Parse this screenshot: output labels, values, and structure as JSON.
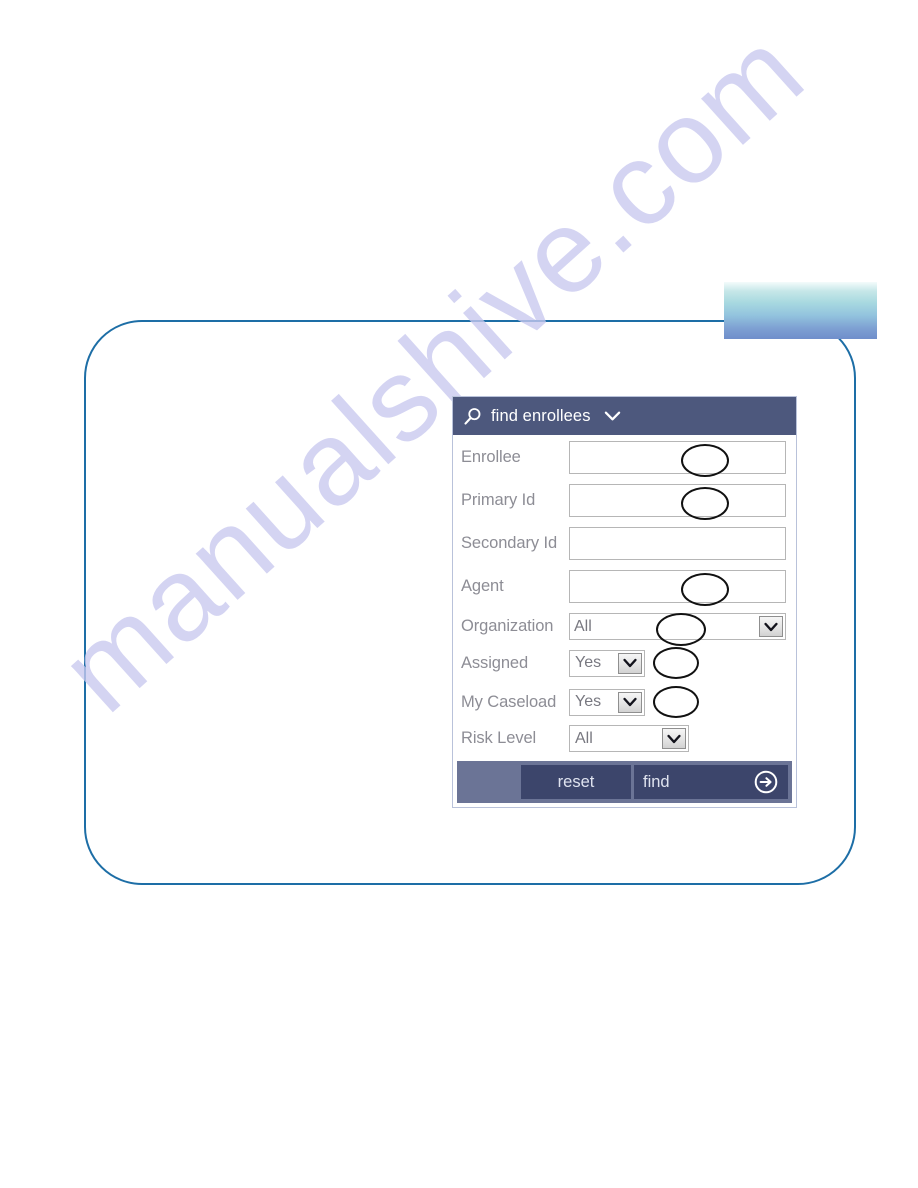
{
  "panel": {
    "header": {
      "title": "find enrollees",
      "search_icon": "search-icon",
      "chevron_icon": "chevron-down-icon"
    },
    "fields": [
      {
        "label": "Enrollee",
        "type": "text",
        "value": "",
        "annotated": true
      },
      {
        "label": "Primary Id",
        "type": "text",
        "value": "",
        "annotated": true
      },
      {
        "label": "Secondary Id",
        "type": "text",
        "value": "",
        "annotated": false
      },
      {
        "label": "Agent",
        "type": "text",
        "value": "",
        "annotated": true
      },
      {
        "label": "Organization",
        "type": "select",
        "value": "All",
        "annotated": true
      },
      {
        "label": "Assigned",
        "type": "select",
        "value": "Yes",
        "annotated": true
      },
      {
        "label": "My Caseload",
        "type": "select",
        "value": "Yes",
        "annotated": true
      },
      {
        "label": "Risk Level",
        "type": "select",
        "value": "All",
        "annotated": false
      }
    ],
    "footer": {
      "reset_label": "reset",
      "find_label": "find",
      "go_icon": "arrow-right-circle-icon"
    }
  },
  "watermark": {
    "text": "manualshive.com"
  },
  "colors": {
    "header_bar": "#4d587d",
    "footer_bar": "#6b7496",
    "button": "#3c456b",
    "frame_outline": "#1d6ea6",
    "label_text": "#8d8d95",
    "accent_gradient_top": "#f4fbfb",
    "accent_gradient_bottom": "#6f8ecb",
    "annotation": "#111111",
    "watermark": "#c9c9ef"
  }
}
